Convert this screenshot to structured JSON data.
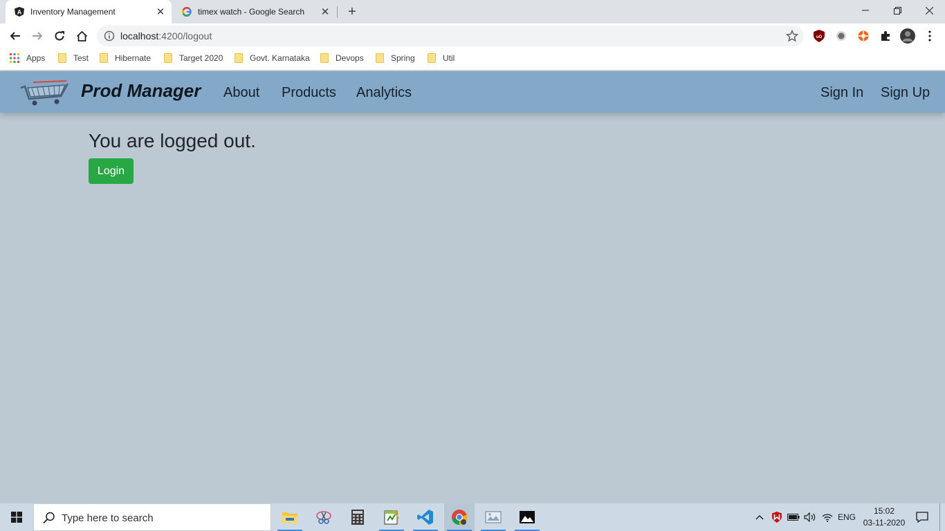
{
  "browser": {
    "tabs": [
      {
        "title": "Inventory Management",
        "active": true,
        "favicon": "angular-icon"
      },
      {
        "title": "timex watch - Google Search",
        "active": false,
        "favicon": "google-icon"
      }
    ],
    "url_host": "localhost",
    "url_path": ":4200/logout",
    "bookmarks": [
      {
        "label": "Apps",
        "icon": "apps-grid-icon"
      },
      {
        "label": "Test",
        "icon": "folder-icon"
      },
      {
        "label": "Hibernate",
        "icon": "folder-icon"
      },
      {
        "label": "Target 2020",
        "icon": "folder-icon"
      },
      {
        "label": "Govt. Karnataka",
        "icon": "folder-icon"
      },
      {
        "label": "Devops",
        "icon": "folder-icon"
      },
      {
        "label": "Spring",
        "icon": "folder-icon"
      },
      {
        "label": "Util",
        "icon": "folder-icon"
      }
    ]
  },
  "navbar": {
    "brand": "Prod Manager",
    "links": [
      "About",
      "Products",
      "Analytics"
    ],
    "auth": [
      "Sign In",
      "Sign Up"
    ],
    "color": "#84a8c7"
  },
  "main": {
    "message": "You are logged out.",
    "login_label": "Login",
    "login_color": "#28a745"
  },
  "taskbar": {
    "search_placeholder": "Type here to search",
    "language": "ENG",
    "time": "15:02",
    "date": "03-11-2020"
  }
}
